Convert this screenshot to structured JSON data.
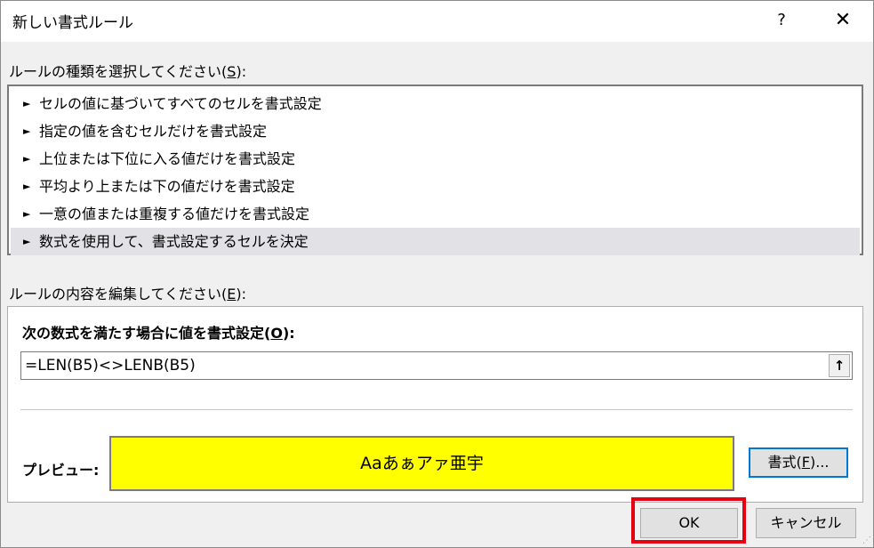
{
  "dialog": {
    "title": "新しい書式ルール",
    "help_label": "?",
    "close_label": "✕"
  },
  "rule_type": {
    "label_pre": "ルールの種類を選択してください(",
    "label_key": "S",
    "label_post": "):",
    "items": [
      {
        "label": "セルの値に基づいてすべてのセルを書式設定",
        "selected": false
      },
      {
        "label": "指定の値を含むセルだけを書式設定",
        "selected": false
      },
      {
        "label": "上位または下位に入る値だけを書式設定",
        "selected": false
      },
      {
        "label": "平均より上または下の値だけを書式設定",
        "selected": false
      },
      {
        "label": "一意の値または重複する値だけを書式設定",
        "selected": false
      },
      {
        "label": "数式を使用して、書式設定するセルを決定",
        "selected": true
      }
    ],
    "arrow_glyph": "►"
  },
  "rule_edit": {
    "label_pre": "ルールの内容を編集してください(",
    "label_key": "E",
    "label_post": "):",
    "formula_label_pre": "次の数式を満たす場合に値を書式設定(",
    "formula_label_key": "O",
    "formula_label_post": "):",
    "formula_value": "=LEN(B5)<>LENB(B5)",
    "collapse_icon": "🠕",
    "preview_label": "プレビュー:",
    "preview_text": "Aaあぁアァ亜宇",
    "preview_bg": "#ffff00",
    "format_button_pre": "書式(",
    "format_button_key": "F",
    "format_button_post": ")..."
  },
  "footer": {
    "ok_label": "OK",
    "cancel_label": "キャンセル",
    "highlight_color": "#e60012"
  }
}
